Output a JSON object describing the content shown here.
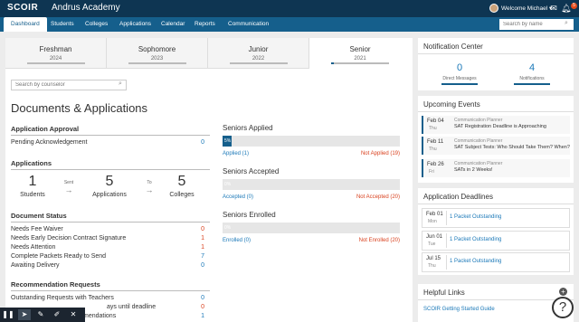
{
  "header": {
    "logo": "SCOIR",
    "school": "Andrus Academy",
    "welcome": "Welcome Michael",
    "notification_count": "5",
    "icons": [
      "chat-icon",
      "bell-icon"
    ]
  },
  "nav": {
    "tabs": [
      "Dashboard",
      "Students",
      "Colleges",
      "Applications",
      "Calendar",
      "Reports",
      "Communication"
    ],
    "active": "Dashboard",
    "search_placeholder": "Search by name"
  },
  "years": [
    {
      "name": "Freshman",
      "year": "2024",
      "progress": 0
    },
    {
      "name": "Sophomore",
      "year": "2023",
      "progress": 0
    },
    {
      "name": "Junior",
      "year": "2022",
      "progress": 0
    },
    {
      "name": "Senior",
      "year": "2021",
      "progress": 0.05
    }
  ],
  "counselor_placeholder": "Search by counselor",
  "page_title": "Documents & Applications",
  "application_approval": {
    "title": "Application Approval",
    "rows": [
      {
        "label": "Pending Acknowledgement",
        "value": "0"
      }
    ]
  },
  "applications": {
    "title": "Applications",
    "students": {
      "value": "1",
      "label": "Students"
    },
    "sent_label": "Sent",
    "apps": {
      "value": "5",
      "label": "Applications"
    },
    "to_label": "To",
    "colleges": {
      "value": "5",
      "label": "Colleges"
    }
  },
  "document_status": {
    "title": "Document Status",
    "rows": [
      {
        "label": "Needs Fee Waiver",
        "value": "0"
      },
      {
        "label": "Needs Early Decision Contract Signature",
        "value": "1"
      },
      {
        "label": "Needs Attention",
        "value": "1"
      },
      {
        "label": "Complete Packets Ready to Send",
        "value": "7"
      },
      {
        "label": "Awaiting Delivery",
        "value": "0"
      }
    ]
  },
  "recommendation_requests": {
    "title": "Recommendation Requests",
    "rows": [
      {
        "label": "Outstanding Requests with Teachers",
        "value": "0"
      },
      {
        "label": "ays until deadline",
        "value": "0"
      },
      {
        "label": "mendations",
        "value": "1"
      }
    ]
  },
  "seniors": [
    {
      "title": "Seniors Applied",
      "percent_label": "5%",
      "percent": 5,
      "left": "Applied (1)",
      "right": "Not Applied (19)"
    },
    {
      "title": "Seniors Accepted",
      "percent_label": "0%",
      "percent": 0,
      "left": "Accepted (0)",
      "right": "Not Accepted (20)"
    },
    {
      "title": "Seniors Enrolled",
      "percent_label": "0%",
      "percent": 0,
      "left": "Enrolled (0)",
      "right": "Not Enrolled (20)"
    }
  ],
  "notification_center": {
    "title": "Notification Center",
    "direct": {
      "value": "0",
      "label": "Direct Messages"
    },
    "notifications": {
      "value": "4",
      "label": "Notifications"
    }
  },
  "upcoming_events": {
    "title": "Upcoming Events",
    "items": [
      {
        "date": "Feb 04",
        "day": "Thu",
        "category": "Communication Planner",
        "title": "SAT Registration Deadline is Approaching"
      },
      {
        "date": "Feb 11",
        "day": "Thu",
        "category": "Communication Planner",
        "title": "SAT Subject Tests: Who Should Take Them? When?"
      },
      {
        "date": "Feb 26",
        "day": "Fri",
        "category": "Communication Planner",
        "title": "SATs in 2 Weeks!"
      }
    ]
  },
  "deadlines": {
    "title": "Application Deadlines",
    "items": [
      {
        "date": "Feb 01",
        "day": "Mon",
        "text": "1 Packet Outstanding"
      },
      {
        "date": "Jun 01",
        "day": "Tue",
        "text": "1 Packet Outstanding"
      },
      {
        "date": "Jul 15",
        "day": "Thu",
        "text": "1 Packet Outstanding"
      }
    ]
  },
  "helpful_links": {
    "title": "Helpful Links",
    "items": [
      "SCOIR Getting Started Guide"
    ]
  },
  "help_symbol": "?",
  "toolbar": [
    "pause-icon",
    "pointer-icon",
    "pen-icon",
    "highlighter-icon",
    "close-icon"
  ],
  "colors": {
    "nav_dark": "#0e3552",
    "nav": "#155f8c",
    "link": "#1a78b8",
    "alert": "#d9411e"
  }
}
